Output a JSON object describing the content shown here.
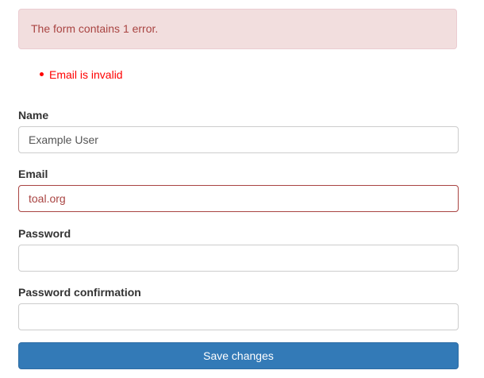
{
  "alert": {
    "message": "The form contains 1 error."
  },
  "errors": [
    "Email is invalid"
  ],
  "form": {
    "name_label": "Name",
    "name_value": "Example User",
    "email_label": "Email",
    "email_value": "toal.org",
    "password_label": "Password",
    "password_value": "",
    "password_confirmation_label": "Password confirmation",
    "password_confirmation_value": "",
    "submit_label": "Save changes"
  },
  "colors": {
    "alert_background": "#f2dede",
    "alert_text": "#a94442",
    "error_text": "#ff0000",
    "invalid_border": "#a94442",
    "button_background": "#337ab7"
  }
}
